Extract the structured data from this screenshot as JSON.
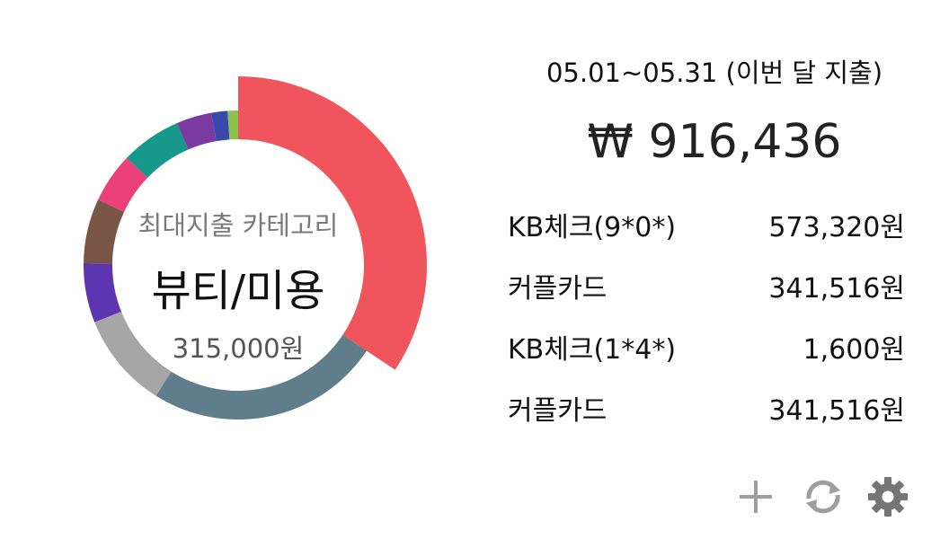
{
  "widget": {
    "period_label": "05.01~05.31 (이번 달 지출)",
    "total_amount": "₩ 916,436",
    "center": {
      "caption": "최대지출 카테고리",
      "top_category": "뷰티/미용",
      "top_amount": "315,000원"
    },
    "cards": [
      {
        "name": "KB체크(9*0*)",
        "amount": "573,320원"
      },
      {
        "name": "커플카드",
        "amount": "341,516원"
      },
      {
        "name": "KB체크(1*4*)",
        "amount": "1,600원"
      },
      {
        "name": "커플카드",
        "amount": "341,516원"
      }
    ],
    "actions": {
      "add_icon": "plus-icon",
      "refresh_icon": "refresh-icon",
      "settings_icon": "gear-icon"
    },
    "icon_color": "#9e9e9e"
  },
  "chart_data": {
    "type": "pie",
    "style": "donut",
    "total": 916436,
    "slices": [
      {
        "value": 315000,
        "color": "#f0545c"
      },
      {
        "value": 225000,
        "color": "#607d8b"
      },
      {
        "value": 92000,
        "color": "#a6a6a6"
      },
      {
        "value": 57000,
        "color": "#5e35b1"
      },
      {
        "value": 62000,
        "color": "#795548"
      },
      {
        "value": 48000,
        "color": "#ec407a"
      },
      {
        "value": 58000,
        "color": "#16998a"
      },
      {
        "value": 34000,
        "color": "#7b3aa0"
      },
      {
        "value": 15436,
        "color": "#3949ab"
      },
      {
        "value": 10000,
        "color": "#8bc34a"
      }
    ]
  }
}
